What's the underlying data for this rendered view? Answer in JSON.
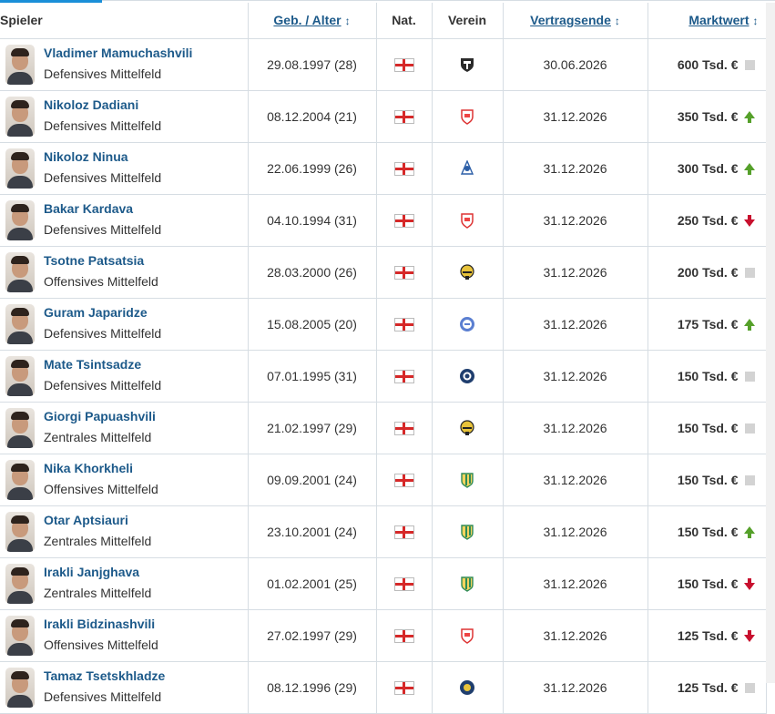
{
  "header": {
    "spieler": "Spieler",
    "geb_alter": "Geb. / Alter",
    "nat": "Nat.",
    "verein": "Verein",
    "vertragsende": "Vertragsende",
    "marktwert": "Marktwert",
    "sort_icon": "↕"
  },
  "colors": {
    "link": "#1d5a8a",
    "up": "#55a02a",
    "down": "#c8102e",
    "neutral": "#d3d3d3"
  },
  "rows": [
    {
      "name": "Vladimer Mamuchashvili",
      "position": "Defensives Mittelfeld",
      "birth": "29.08.1997 (28)",
      "nationality": "Georgia",
      "club_icon": "shield-crest-icon",
      "contract": "30.06.2026",
      "value": "600 Tsd. €",
      "trend": "neutral"
    },
    {
      "name": "Nikoloz Dadiani",
      "position": "Defensives Mittelfeld",
      "birth": "08.12.2004 (21)",
      "nationality": "Georgia",
      "club_icon": "red-shield-crest-icon",
      "contract": "31.12.2026",
      "value": "350 Tsd. €",
      "trend": "up"
    },
    {
      "name": "Nikoloz Ninua",
      "position": "Defensives Mittelfeld",
      "birth": "22.06.1999 (26)",
      "nationality": "Georgia",
      "club_icon": "dinamo-crest-icon",
      "contract": "31.12.2026",
      "value": "300 Tsd. €",
      "trend": "up"
    },
    {
      "name": "Bakar Kardava",
      "position": "Defensives Mittelfeld",
      "birth": "04.10.1994 (31)",
      "nationality": "Georgia",
      "club_icon": "red-shield-crest-icon",
      "contract": "31.12.2026",
      "value": "250 Tsd. €",
      "trend": "down"
    },
    {
      "name": "Tsotne Patsatsia",
      "position": "Offensives Mittelfeld",
      "birth": "28.03.2000 (26)",
      "nationality": "Georgia",
      "club_icon": "yellow-black-crest-icon",
      "contract": "31.12.2026",
      "value": "200 Tsd. €",
      "trend": "neutral"
    },
    {
      "name": "Guram Japaridze",
      "position": "Defensives Mittelfeld",
      "birth": "15.08.2005 (20)",
      "nationality": "Georgia",
      "club_icon": "blue-round-crest-icon",
      "contract": "31.12.2026",
      "value": "175 Tsd. €",
      "trend": "up"
    },
    {
      "name": "Mate Tsintsadze",
      "position": "Defensives Mittelfeld",
      "birth": "07.01.1995 (31)",
      "nationality": "Georgia",
      "club_icon": "navy-round-crest-icon",
      "contract": "31.12.2026",
      "value": "150 Tsd. €",
      "trend": "neutral"
    },
    {
      "name": "Giorgi Papuashvili",
      "position": "Zentrales Mittelfeld",
      "birth": "21.02.1997 (29)",
      "nationality": "Georgia",
      "club_icon": "yellow-black-crest-icon",
      "contract": "31.12.2026",
      "value": "150 Tsd. €",
      "trend": "neutral"
    },
    {
      "name": "Nika Khorkheli",
      "position": "Offensives Mittelfeld",
      "birth": "09.09.2001 (24)",
      "nationality": "Georgia",
      "club_icon": "green-yellow-crest-icon",
      "contract": "31.12.2026",
      "value": "150 Tsd. €",
      "trend": "neutral"
    },
    {
      "name": "Otar Aptsiauri",
      "position": "Zentrales Mittelfeld",
      "birth": "23.10.2001 (24)",
      "nationality": "Georgia",
      "club_icon": "green-yellow-crest-icon",
      "contract": "31.12.2026",
      "value": "150 Tsd. €",
      "trend": "up"
    },
    {
      "name": "Irakli Janjghava",
      "position": "Zentrales Mittelfeld",
      "birth": "01.02.2001 (25)",
      "nationality": "Georgia",
      "club_icon": "green-yellow-crest-icon",
      "contract": "31.12.2026",
      "value": "150 Tsd. €",
      "trend": "down"
    },
    {
      "name": "Irakli Bidzinashvili",
      "position": "Offensives Mittelfeld",
      "birth": "27.02.1997 (29)",
      "nationality": "Georgia",
      "club_icon": "red-shield-crest-icon",
      "contract": "31.12.2026",
      "value": "125 Tsd. €",
      "trend": "down"
    },
    {
      "name": "Tamaz Tsetskhladze",
      "position": "Defensives Mittelfeld",
      "birth": "08.12.1996 (29)",
      "nationality": "Georgia",
      "club_icon": "navy-gold-crest-icon",
      "contract": "31.12.2026",
      "value": "125 Tsd. €",
      "trend": "neutral"
    }
  ]
}
